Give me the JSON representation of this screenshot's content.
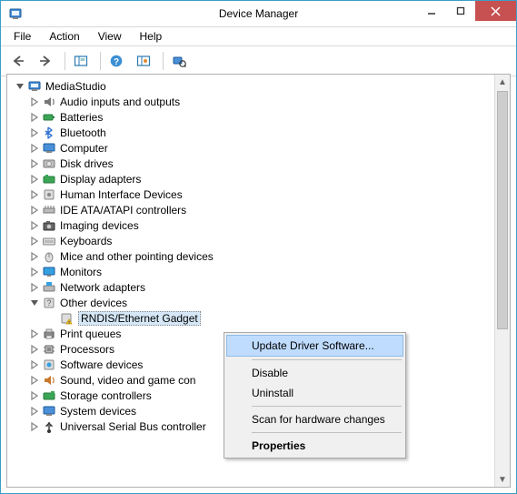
{
  "window": {
    "title": "Device Manager"
  },
  "menubar": [
    "File",
    "Action",
    "View",
    "Help"
  ],
  "tree": {
    "root": "MediaStudio",
    "children": [
      "Audio inputs and outputs",
      "Batteries",
      "Bluetooth",
      "Computer",
      "Disk drives",
      "Display adapters",
      "Human Interface Devices",
      "IDE ATA/ATAPI controllers",
      "Imaging devices",
      "Keyboards",
      "Mice and other pointing devices",
      "Monitors",
      "Network adapters",
      "Other devices",
      "Print queues",
      "Processors",
      "Software devices",
      "Sound, video and game con",
      "Storage controllers",
      "System devices",
      "Universal Serial Bus controller"
    ],
    "other_devices_child": "RNDIS/Ethernet Gadget"
  },
  "context_menu": {
    "update": "Update Driver Software...",
    "disable": "Disable",
    "uninstall": "Uninstall",
    "scan": "Scan for hardware changes",
    "properties": "Properties"
  }
}
